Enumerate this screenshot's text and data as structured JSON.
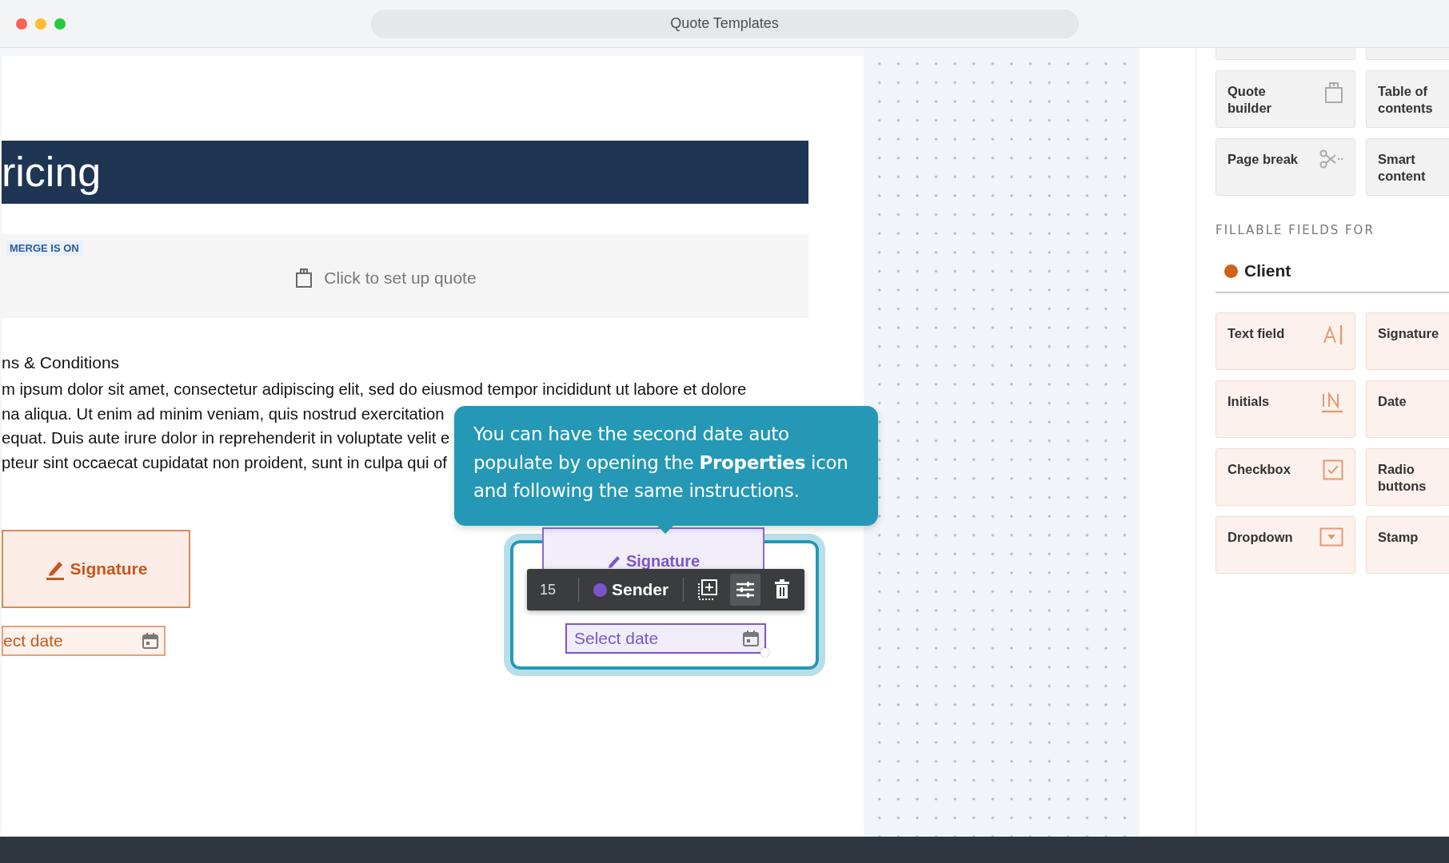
{
  "window": {
    "title": "Quote Templates"
  },
  "document": {
    "header": "ricing",
    "quote_block": {
      "badge": "MERGE IS ON",
      "prompt": "Click to set up quote"
    },
    "terms": {
      "heading": "ns & Conditions",
      "lines": [
        "m ipsum dolor sit amet, consectetur adipiscing elit, sed do eiusmod tempor incididunt ut labore et dolore",
        "na aliqua. Ut enim ad minim veniam, quis nostrud exercitation",
        "equat. Duis aute irure dolor in reprehenderit in voluptate velit e",
        "pteur sint occaecat cupidatat non proident, sunt in culpa qui of"
      ]
    },
    "client_field": {
      "signature": "Signature",
      "date_placeholder": "ect date"
    },
    "selected_field": {
      "signature": "Signature",
      "date_placeholder": "Select date",
      "toolbar": {
        "page": "15",
        "role": "Sender",
        "buttons": [
          {
            "kind": "add",
            "selected": false
          },
          {
            "kind": "properties",
            "selected": true
          },
          {
            "kind": "delete",
            "selected": false
          }
        ]
      }
    }
  },
  "tooltip": {
    "text": "You can have the second date auto populate by opening the **Properties** icon and following the same instructions."
  },
  "sidebar": {
    "content_blocks": [
      {
        "label": "Quote builder",
        "kind": "bag"
      },
      {
        "label": "Table of contents"
      },
      {
        "label": "Page break",
        "kind": "scissors"
      },
      {
        "label": "Smart content"
      }
    ],
    "fillable_heading": "FILLABLE FIELDS FOR",
    "recipient": {
      "name": "Client",
      "color": "#d0611b"
    },
    "fields": [
      {
        "label": "Text field",
        "kind": "text"
      },
      {
        "label": "Signature"
      },
      {
        "label": "Initials",
        "kind": "initials"
      },
      {
        "label": "Date"
      },
      {
        "label": "Checkbox",
        "kind": "checkbox"
      },
      {
        "label": "Radio buttons"
      },
      {
        "label": "Dropdown",
        "kind": "dropdown"
      },
      {
        "label": "Stamp"
      }
    ]
  }
}
